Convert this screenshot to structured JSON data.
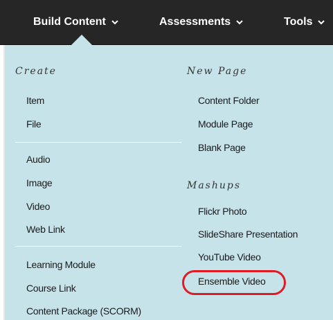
{
  "toolbar": {
    "build_content": "Build Content",
    "assessments": "Assessments",
    "tools": "Tools"
  },
  "menu": {
    "left": {
      "heading": "Create",
      "group1": [
        "Item",
        "File"
      ],
      "group2": [
        "Audio",
        "Image",
        "Video",
        "Web Link"
      ],
      "group3": [
        "Learning Module",
        "Course Link",
        "Content Package (SCORM)"
      ]
    },
    "right": {
      "new_page_heading": "New Page",
      "new_page_items": [
        "Content Folder",
        "Module Page",
        "Blank Page"
      ],
      "mashups_heading": "Mashups",
      "mashups_items": [
        "Flickr Photo",
        "SlideShare Presentation",
        "YouTube Video",
        "Ensemble Video"
      ]
    }
  },
  "colors": {
    "toolbar_bg": "#262626",
    "panel_bg": "#c6e3ea",
    "highlight_ring": "#e01b24"
  }
}
